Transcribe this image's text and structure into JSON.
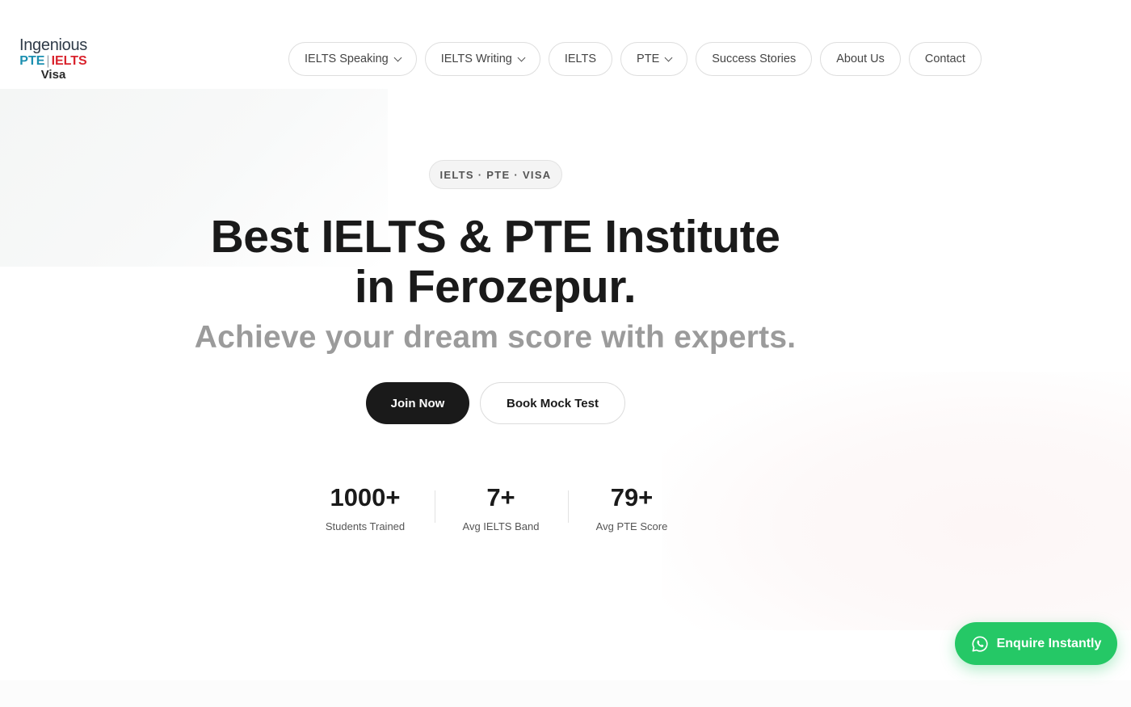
{
  "logo": {
    "line1": "Ingenious",
    "pte": "PTE",
    "separator": "|",
    "ielts": "IELTS",
    "line3": "Visa"
  },
  "nav": {
    "items": [
      {
        "label": "IELTS Speaking",
        "has_dropdown": true
      },
      {
        "label": "IELTS Writing",
        "has_dropdown": true
      },
      {
        "label": "IELTS",
        "has_dropdown": false
      },
      {
        "label": "PTE",
        "has_dropdown": true
      },
      {
        "label": "Success Stories",
        "has_dropdown": false
      },
      {
        "label": "About Us",
        "has_dropdown": false
      },
      {
        "label": "Contact",
        "has_dropdown": false
      }
    ]
  },
  "hero": {
    "badge": "IELTS · PTE · VISA",
    "title_line1": "Best IELTS & PTE Institute",
    "title_line2": "in Ferozepur.",
    "subtitle": "Achieve your dream score with experts.",
    "primary_button": "Join Now",
    "secondary_button": "Book Mock Test"
  },
  "stats": [
    {
      "value": "1000+",
      "label": "Students Trained"
    },
    {
      "value": "7+",
      "label": "Avg IELTS Band"
    },
    {
      "value": "79+",
      "label": "Avg PTE Score"
    }
  ],
  "enquire": {
    "label": "Enquire Instantly",
    "icon": "whatsapp-icon"
  },
  "colors": {
    "text_primary": "#1a1a1a",
    "text_muted": "#9b9b9b",
    "accent_pte": "#1b8fb0",
    "accent_ielts": "#d9232d",
    "whatsapp_green": "#25c866"
  }
}
